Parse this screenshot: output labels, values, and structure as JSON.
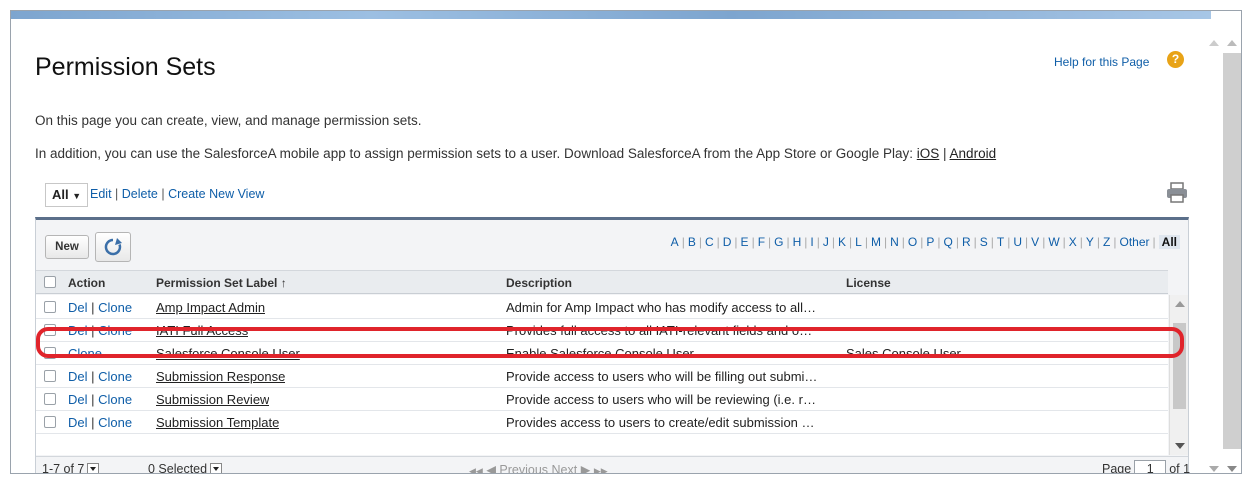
{
  "header": {
    "title": "Permission Sets",
    "help_label": "Help for this Page",
    "help_icon": "help-icon"
  },
  "intro": {
    "line1": "On this page you can create, view, and manage permission sets.",
    "line2_text": "In addition, you can use the SalesforceA mobile app to assign permission sets to a user. Download SalesforceA from the App Store or Google Play: ",
    "ios": "iOS",
    "sep": " | ",
    "android": "Android"
  },
  "view": {
    "selected": "All",
    "edit": "Edit",
    "delete": "Delete",
    "create": "Create New View",
    "sep": " | "
  },
  "toolbar": {
    "new_label": "New",
    "alphabet": [
      "A",
      "B",
      "C",
      "D",
      "E",
      "F",
      "G",
      "H",
      "I",
      "J",
      "K",
      "L",
      "M",
      "N",
      "O",
      "P",
      "Q",
      "R",
      "S",
      "T",
      "U",
      "V",
      "W",
      "X",
      "Y",
      "Z",
      "Other",
      "All"
    ],
    "active": "All"
  },
  "columns": {
    "action": "Action",
    "label": "Permission Set Label ↑",
    "description": "Description",
    "license": "License"
  },
  "rows": [
    {
      "del": "Del",
      "clone": "Clone",
      "label": "Amp Impact Admin",
      "description": "Admin for Amp Impact who has modify access to all…",
      "license": ""
    },
    {
      "del": "Del",
      "clone": "Clone",
      "label": "IATI Full Access",
      "description": "Provides full access to all IATI-relevant fields and o…",
      "license": ""
    },
    {
      "del": "",
      "clone": "Clone",
      "label": "Salesforce Console User",
      "description": "Enable Salesforce Console User",
      "license": "Sales Console User"
    },
    {
      "del": "Del",
      "clone": "Clone",
      "label": "Submission Response",
      "description": "Provide access to users who will be filling out submi…",
      "license": ""
    },
    {
      "del": "Del",
      "clone": "Clone",
      "label": "Submission Review",
      "description": "Provide access to users who will be reviewing (i.e. r…",
      "license": ""
    },
    {
      "del": "Del",
      "clone": "Clone",
      "label": "Submission Template",
      "description": "Provides access to users to create/edit submission …",
      "license": ""
    }
  ],
  "footer": {
    "range": "1-7 of 7",
    "selected": "0 Selected",
    "first": "◀◀",
    "prev": "◀ Previous",
    "next": "Next ▶",
    "last": "▶▶",
    "page_label": "Page",
    "page_value": "1",
    "of_label": "of 1"
  },
  "colors": {
    "link": "#0f5ea8",
    "highlight": "#e0242b",
    "help_icon": "#e8a317"
  }
}
